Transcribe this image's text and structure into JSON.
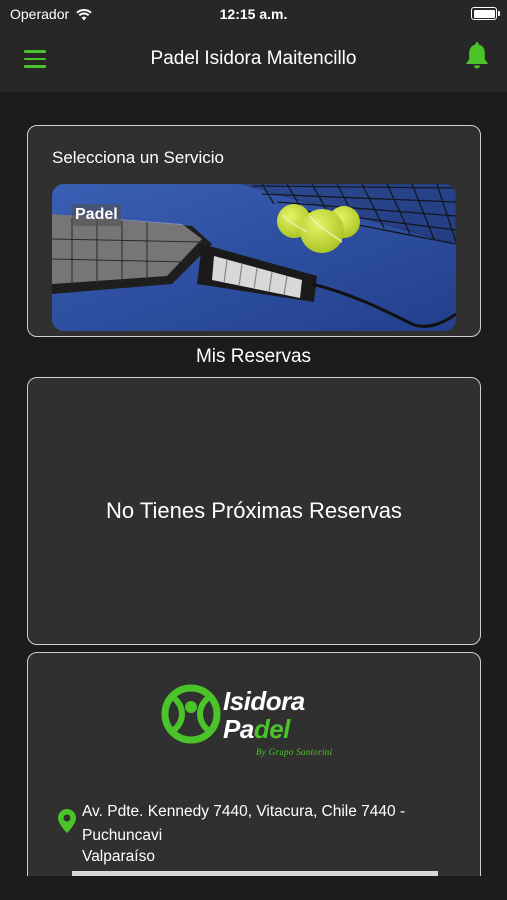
{
  "status_bar": {
    "carrier": "Operador",
    "time": "12:15 a.m."
  },
  "nav": {
    "title": "Padel Isidora Maitencillo",
    "menu_icon": "hamburger-icon",
    "bell_icon": "bell-icon"
  },
  "service_card": {
    "title": "Selecciona un Servicio",
    "service_label": "Padel"
  },
  "reservas": {
    "title": "Mis Reservas",
    "empty_text": "No Tienes Próximas Reservas"
  },
  "club": {
    "logo_line1": "Isidora",
    "logo_line2_a": "Pa",
    "logo_line2_b": "del",
    "logo_sub": "By Grupo Santorini",
    "address": "Av. Pdte. Kennedy 7440, Vitacura, Chile 7440 - Puchuncavi",
    "region": "Valparaíso"
  },
  "colors": {
    "accent": "#4bc42a",
    "background": "#1c1c1c",
    "card": "#303030",
    "bar": "#272727"
  }
}
